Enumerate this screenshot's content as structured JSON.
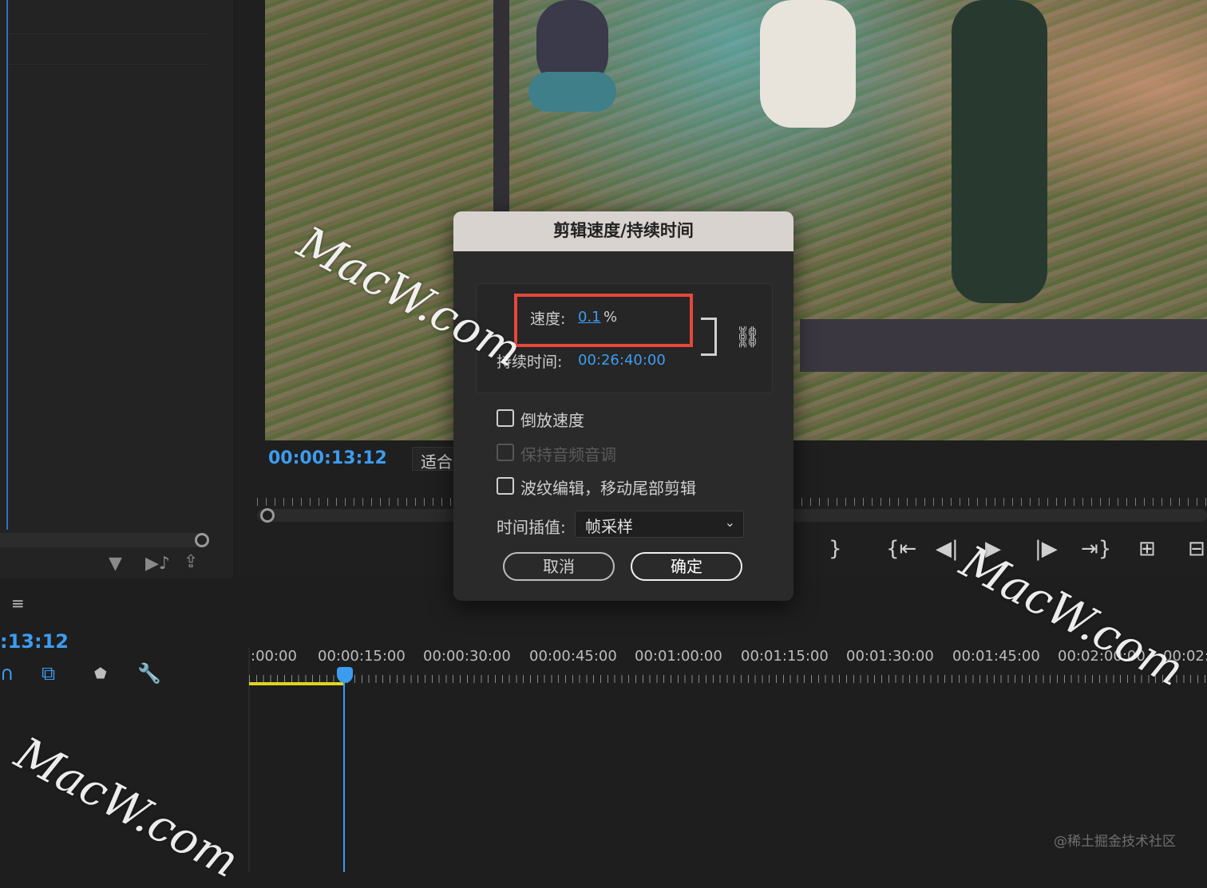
{
  "monitor": {
    "timecode": "00:00:13:12",
    "fit_label": "适合"
  },
  "timeline": {
    "timecode": ":13:12",
    "menu_icon": "≡",
    "ruler_labels": [
      ":00:00",
      "00:00:15:00",
      "00:00:30:00",
      "00:00:45:00",
      "00:01:00:00",
      "00:01:15:00",
      "00:01:30:00",
      "00:01:45:00",
      "00:02:00:00",
      "00:02:"
    ]
  },
  "dialog": {
    "title": "剪辑速度/持续时间",
    "speed_label": "速度:",
    "speed_value": "0.1",
    "speed_unit": "%",
    "duration_label": "持续时间:",
    "duration_value": "00:26:40:00",
    "reverse_label": "倒放速度",
    "maintain_audio_label": "保持音频音调",
    "ripple_label": "波纹编辑，移动尾部剪辑",
    "interp_label": "时间插值:",
    "interp_value": "帧采样",
    "cancel_label": "取消",
    "ok_label": "确定"
  },
  "watermarks": [
    "MacW.com",
    "MacW.com",
    "MacW.com"
  ],
  "credit": "@稀土掘金技术社区",
  "colors": {
    "accent": "#3d9cf0",
    "highlight": "#e5473c",
    "work_area": "#e0d320"
  }
}
